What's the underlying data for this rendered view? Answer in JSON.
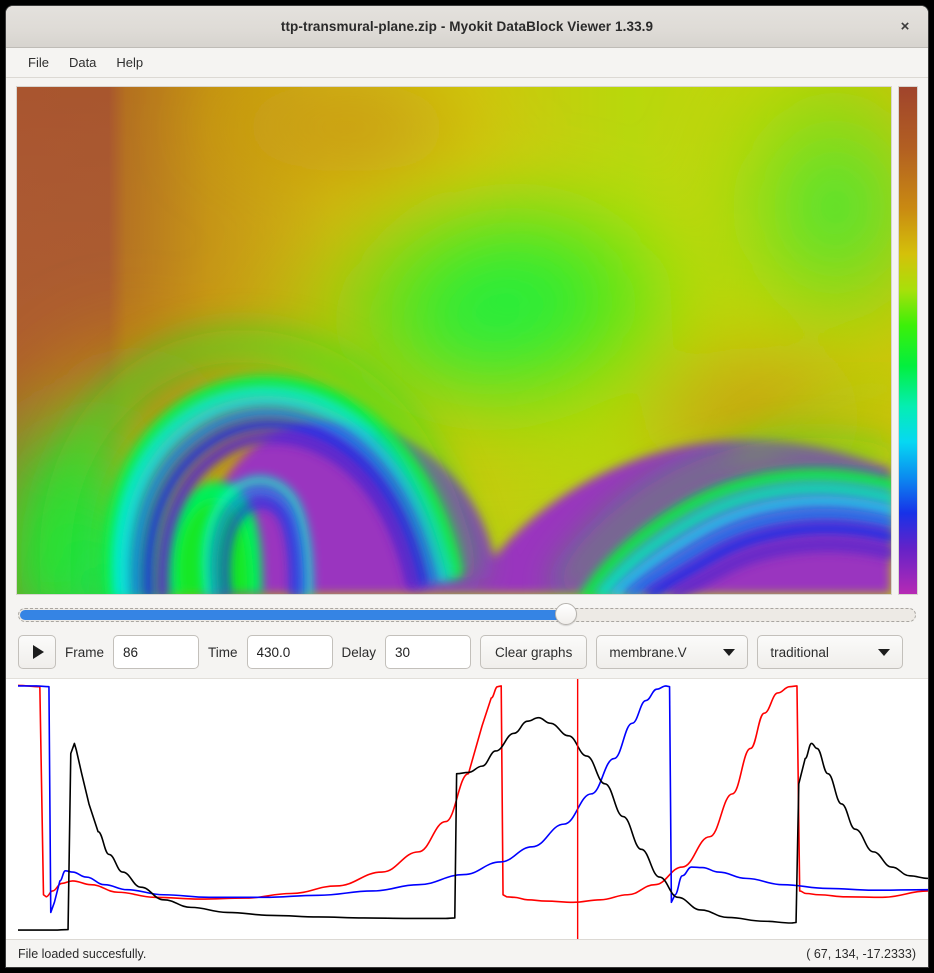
{
  "window": {
    "title": "ttp-transmural-plane.zip - Myokit DataBlock Viewer 1.33.9",
    "close_label": "×"
  },
  "menu": {
    "items": [
      {
        "label": "File"
      },
      {
        "label": "Data"
      },
      {
        "label": "Help"
      }
    ]
  },
  "slider": {
    "value_percent": 61,
    "min": 0,
    "max": 100
  },
  "toolbar": {
    "play_label": "play-icon",
    "frame_label": "Frame",
    "frame_value": "86",
    "time_label": "Time",
    "time_value": "430.0",
    "delay_label": "Delay",
    "delay_value": "30",
    "clear_graphs_label": "Clear graphs",
    "variable_selected": "membrane.V",
    "colormap_selected": "traditional"
  },
  "status": {
    "message": "File loaded succesfully.",
    "coordinates": "( 67, 134, -17.2333)"
  },
  "colorbar": {
    "stops": [
      {
        "offset": 0,
        "color": "#a0442c"
      },
      {
        "offset": 12,
        "color": "#b25f22"
      },
      {
        "offset": 24,
        "color": "#c98a12"
      },
      {
        "offset": 33,
        "color": "#d4c10a"
      },
      {
        "offset": 40,
        "color": "#a8e00a"
      },
      {
        "offset": 47,
        "color": "#3cf009"
      },
      {
        "offset": 55,
        "color": "#03ef3e"
      },
      {
        "offset": 63,
        "color": "#05eeb2"
      },
      {
        "offset": 70,
        "color": "#06d8f2"
      },
      {
        "offset": 77,
        "color": "#0b8bf0"
      },
      {
        "offset": 84,
        "color": "#1732e8"
      },
      {
        "offset": 91,
        "color": "#6422c8"
      },
      {
        "offset": 100,
        "color": "#b62ab4"
      }
    ]
  },
  "heatmap": {
    "description": "membrane voltage field, spiral re-entry wave",
    "palette": {
      "rest_brown": "#a9552f",
      "orange": "#c08a1e",
      "yellow": "#d4c511",
      "yellow_green": "#a8e00a",
      "green": "#18e618",
      "bright_green": "#06f05a",
      "cyan": "#0ae8e0",
      "blue": "#1a35e6",
      "purple": "#9a35bf"
    }
  },
  "chart_data": {
    "type": "line",
    "title": "",
    "xlabel": "",
    "ylabel": "",
    "grid": false,
    "legend": null,
    "cursor_x_fraction": 0.615,
    "cursor_color": "#ff0000",
    "series": [
      {
        "name": "trace-red",
        "color": "#ff0000",
        "points": [
          [
            0.0,
            0.99
          ],
          [
            0.024,
            0.985
          ],
          [
            0.028,
            0.16
          ],
          [
            0.031,
            0.152
          ],
          [
            0.038,
            0.175
          ],
          [
            0.048,
            0.205
          ],
          [
            0.06,
            0.215
          ],
          [
            0.08,
            0.2
          ],
          [
            0.11,
            0.17
          ],
          [
            0.15,
            0.15
          ],
          [
            0.2,
            0.143
          ],
          [
            0.25,
            0.147
          ],
          [
            0.3,
            0.165
          ],
          [
            0.35,
            0.195
          ],
          [
            0.4,
            0.25
          ],
          [
            0.44,
            0.33
          ],
          [
            0.47,
            0.45
          ],
          [
            0.495,
            0.64
          ],
          [
            0.51,
            0.83
          ],
          [
            0.52,
            0.94
          ],
          [
            0.527,
            0.985
          ],
          [
            0.531,
            0.988
          ],
          [
            0.533,
            0.16
          ],
          [
            0.537,
            0.152
          ],
          [
            0.545,
            0.15
          ],
          [
            0.56,
            0.14
          ],
          [
            0.58,
            0.135
          ],
          [
            0.61,
            0.13
          ],
          [
            0.64,
            0.14
          ],
          [
            0.67,
            0.16
          ],
          [
            0.7,
            0.2
          ],
          [
            0.73,
            0.27
          ],
          [
            0.76,
            0.39
          ],
          [
            0.785,
            0.56
          ],
          [
            0.805,
            0.74
          ],
          [
            0.82,
            0.88
          ],
          [
            0.835,
            0.96
          ],
          [
            0.848,
            0.985
          ],
          [
            0.856,
            0.988
          ],
          [
            0.859,
            0.175
          ],
          [
            0.866,
            0.165
          ],
          [
            0.88,
            0.16
          ],
          [
            0.91,
            0.152
          ],
          [
            0.95,
            0.15
          ],
          [
            1.0,
            0.175
          ]
        ]
      },
      {
        "name": "trace-blue",
        "color": "#0000ff",
        "points": [
          [
            0.0,
            0.988
          ],
          [
            0.02,
            0.988
          ],
          [
            0.034,
            0.985
          ],
          [
            0.036,
            0.09
          ],
          [
            0.04,
            0.13
          ],
          [
            0.046,
            0.215
          ],
          [
            0.052,
            0.255
          ],
          [
            0.06,
            0.25
          ],
          [
            0.075,
            0.23
          ],
          [
            0.095,
            0.2
          ],
          [
            0.12,
            0.18
          ],
          [
            0.16,
            0.16
          ],
          [
            0.21,
            0.15
          ],
          [
            0.27,
            0.15
          ],
          [
            0.33,
            0.158
          ],
          [
            0.39,
            0.175
          ],
          [
            0.44,
            0.2
          ],
          [
            0.49,
            0.24
          ],
          [
            0.53,
            0.29
          ],
          [
            0.565,
            0.35
          ],
          [
            0.6,
            0.44
          ],
          [
            0.63,
            0.56
          ],
          [
            0.655,
            0.7
          ],
          [
            0.675,
            0.84
          ],
          [
            0.69,
            0.93
          ],
          [
            0.702,
            0.975
          ],
          [
            0.712,
            0.988
          ],
          [
            0.716,
            0.985
          ],
          [
            0.718,
            0.13
          ],
          [
            0.722,
            0.16
          ],
          [
            0.73,
            0.235
          ],
          [
            0.74,
            0.27
          ],
          [
            0.752,
            0.268
          ],
          [
            0.77,
            0.25
          ],
          [
            0.8,
            0.225
          ],
          [
            0.84,
            0.2
          ],
          [
            0.89,
            0.185
          ],
          [
            0.94,
            0.178
          ],
          [
            1.0,
            0.18
          ]
        ]
      },
      {
        "name": "trace-black",
        "color": "#000000",
        "points": [
          [
            0.0,
            0.02
          ],
          [
            0.04,
            0.02
          ],
          [
            0.055,
            0.022
          ],
          [
            0.058,
            0.72
          ],
          [
            0.062,
            0.76
          ],
          [
            0.064,
            0.735
          ],
          [
            0.07,
            0.64
          ],
          [
            0.078,
            0.52
          ],
          [
            0.088,
            0.41
          ],
          [
            0.1,
            0.32
          ],
          [
            0.115,
            0.25
          ],
          [
            0.135,
            0.19
          ],
          [
            0.16,
            0.14
          ],
          [
            0.19,
            0.11
          ],
          [
            0.23,
            0.09
          ],
          [
            0.28,
            0.078
          ],
          [
            0.33,
            0.072
          ],
          [
            0.38,
            0.068
          ],
          [
            0.43,
            0.066
          ],
          [
            0.47,
            0.066
          ],
          [
            0.48,
            0.068
          ],
          [
            0.482,
            0.64
          ],
          [
            0.495,
            0.645
          ],
          [
            0.51,
            0.67
          ],
          [
            0.525,
            0.73
          ],
          [
            0.545,
            0.8
          ],
          [
            0.56,
            0.848
          ],
          [
            0.572,
            0.862
          ],
          [
            0.585,
            0.84
          ],
          [
            0.605,
            0.79
          ],
          [
            0.625,
            0.71
          ],
          [
            0.645,
            0.6
          ],
          [
            0.665,
            0.47
          ],
          [
            0.685,
            0.34
          ],
          [
            0.705,
            0.23
          ],
          [
            0.725,
            0.15
          ],
          [
            0.75,
            0.1
          ],
          [
            0.78,
            0.07
          ],
          [
            0.82,
            0.055
          ],
          [
            0.85,
            0.048
          ],
          [
            0.855,
            0.05
          ],
          [
            0.858,
            0.6
          ],
          [
            0.865,
            0.7
          ],
          [
            0.872,
            0.76
          ],
          [
            0.878,
            0.74
          ],
          [
            0.89,
            0.64
          ],
          [
            0.905,
            0.52
          ],
          [
            0.92,
            0.42
          ],
          [
            0.94,
            0.33
          ],
          [
            0.96,
            0.27
          ],
          [
            0.98,
            0.235
          ],
          [
            1.0,
            0.225
          ]
        ]
      }
    ]
  }
}
